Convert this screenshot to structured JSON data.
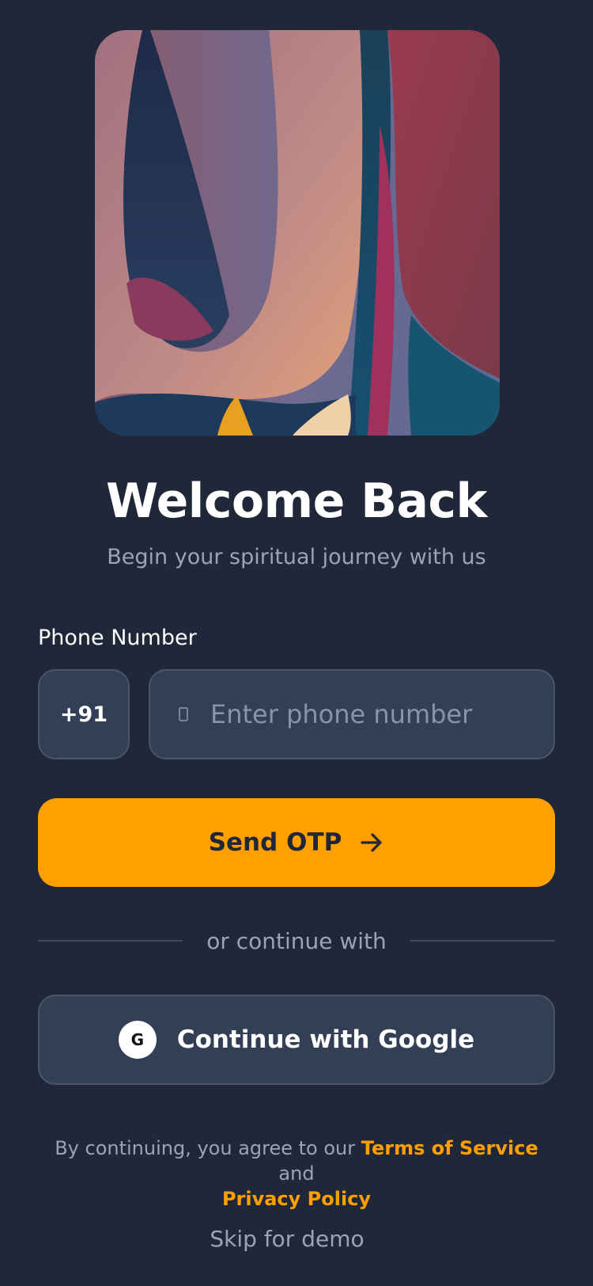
{
  "hero": {
    "alt": "abstract artwork"
  },
  "header": {
    "title": "Welcome Back",
    "subtitle": "Begin your spiritual journey with us"
  },
  "form": {
    "phone_label": "Phone Number",
    "country_code": "+91",
    "phone_placeholder": "Enter phone number",
    "phone_value": "",
    "phone_icon": "phone-icon",
    "send_label": "Send OTP",
    "send_icon": "arrow-right-icon"
  },
  "divider": {
    "text": "or continue with"
  },
  "google": {
    "icon_letter": "G",
    "label": "Continue with Google"
  },
  "legal": {
    "prefix": "By continuing, you agree to our ",
    "terms": "Terms of Service",
    "conjunction": " and",
    "privacy": "Privacy Policy"
  },
  "skip_label": "Skip for demo",
  "colors": {
    "background": "#1f2738",
    "accent": "#ff9f00",
    "card": "#323f54",
    "muted_text": "#9aa3b8"
  }
}
